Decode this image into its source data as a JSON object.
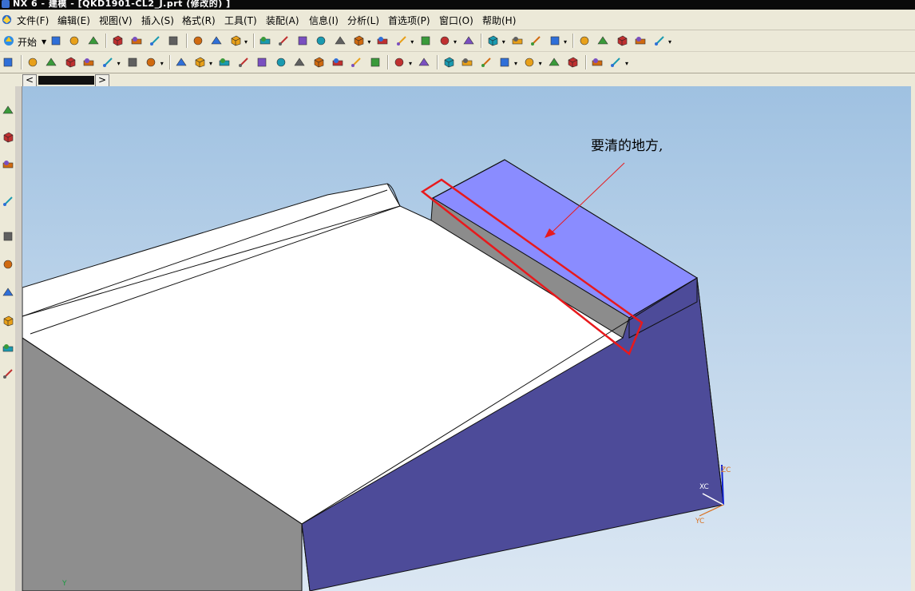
{
  "window": {
    "title": "NX 6 - 建模 - [QKD1901-CL2_J.prt (修改的) ]"
  },
  "menu": {
    "items": [
      "文件(F)",
      "编辑(E)",
      "视图(V)",
      "插入(S)",
      "格式(R)",
      "工具(T)",
      "装配(A)",
      "信息(I)",
      "分析(L)",
      "首选项(P)",
      "窗口(O)",
      "帮助(H)"
    ]
  },
  "toolbar": {
    "start_label": "开始"
  },
  "tabs": {
    "prev": "<",
    "next": ">"
  },
  "viewport": {
    "annotation": "要清的地方,",
    "colors": {
      "top_face": "#8a8cff",
      "side_face": "#4d4b99",
      "left_face": "#8e8e8e",
      "slot_wall": "#8c8c8c",
      "highlight": "#e8191c",
      "arrow": "#e8191c"
    },
    "triad": {
      "zc": "ZC",
      "xc": "XC",
      "yc": "YC"
    },
    "corner_axis": "Y"
  },
  "icons": {
    "menu": "nx-app-icon",
    "toolbar1": [
      "start-icon",
      "new-icon",
      "open-icon",
      "save-icon",
      "cut-icon",
      "copy-icon",
      "paste-icon",
      "undo-icon",
      "redo-icon",
      "repeat-command-icon",
      "selection-filter-icon",
      "fit-icon",
      "zoom-window-icon",
      "zoom-icon",
      "rotate-icon",
      "pan-icon",
      "perspective-icon",
      "shaded-icon",
      "render-style-icon",
      "section-icon",
      "view-orient-icon",
      "wcs-icon",
      "point-icon",
      "snap-icon",
      "vector-icon",
      "direction-icon",
      "select-icon",
      "line-icon",
      "arc-icon",
      "measure-icon",
      "datum-icon"
    ],
    "toolbar2": [
      "feature-icon",
      "extrude-icon",
      "revolve-icon",
      "hole-icon",
      "boss-icon",
      "pocket-icon",
      "blend-icon",
      "chamfer-icon",
      "shell-icon",
      "draft-icon",
      "pattern-icon",
      "mirror-icon",
      "trim-icon",
      "split-icon",
      "boolean-icon",
      "sew-icon",
      "offset-icon",
      "thicken-icon",
      "sweep-icon",
      "curve-icon",
      "spline-icon",
      "sketch-icon",
      "point-set-icon",
      "surface-icon",
      "mesh-icon",
      "through-curves-icon",
      "bounded-plane-icon",
      "studio-icon",
      "transform-icon",
      "analysis-icon"
    ],
    "left": [
      "part-navigator-icon",
      "assembly-navigator-icon",
      "constraint-navigator-icon",
      "reuse-library-icon",
      "history-icon",
      "hd3d-icon",
      "palette-icon",
      "roles-icon",
      "system-materials-icon",
      "web-browser-icon"
    ]
  }
}
